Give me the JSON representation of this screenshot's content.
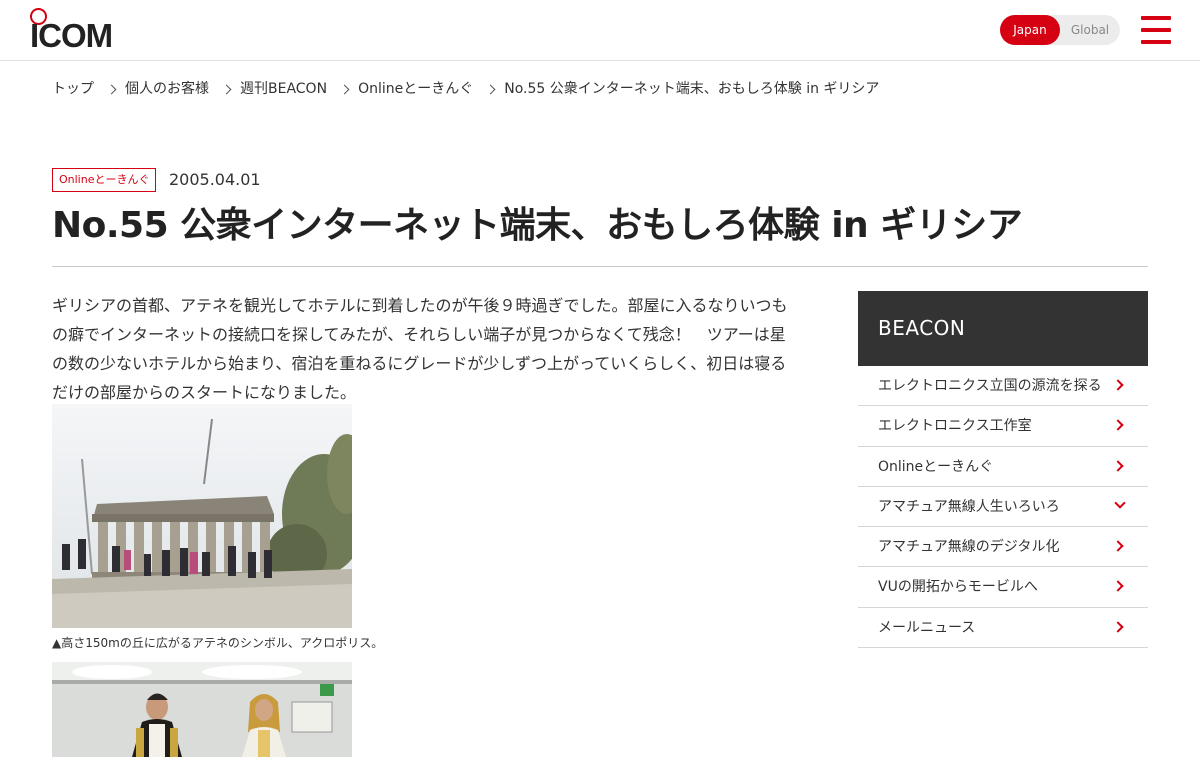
{
  "header": {
    "logo_text": "ICOM",
    "region_japan": "Japan",
    "region_global": "Global",
    "accent_color": "#d50012"
  },
  "breadcrumb": [
    "トップ",
    "個人のお客様",
    "週刊BEACON",
    "Onlineとーきんぐ",
    "No.55 公衆インターネット端末、おもしろ体験 in ギリシア"
  ],
  "meta": {
    "category": "Onlineとーきんぐ",
    "date": "2005.04.01"
  },
  "title": "No.55 公衆インターネット端末、おもしろ体験 in ギリシア",
  "body": {
    "lines": [
      "ギリシアの首都、アテネを観光してホテルに到着したのが午後９時過ぎでした。部屋に入るなりいつも",
      "の癖でインターネットの接続口を探してみたが、それらしい端子が見つからなくて残念！　ツアーは星",
      "の数の少ないホテルから始まり、宿泊を重ねるにグレードが少しずつ上がっていくらしく、初日は寝る",
      "だけの部屋からのスタートになりました。"
    ],
    "caption1": "▲高さ150mの丘に広がるアテネのシンボル、アクロポリス。"
  },
  "sidebar": {
    "title": "BEACON",
    "items": [
      {
        "label": "エレクトロニクス立国の源流を探る",
        "icon": "chevron-right-icon"
      },
      {
        "label": "エレクトロニクス工作室",
        "icon": "chevron-right-icon"
      },
      {
        "label": "Onlineとーきんぐ",
        "icon": "chevron-right-icon"
      },
      {
        "label": "アマチュア無線人生いろいろ",
        "icon": "chevron-down-icon"
      },
      {
        "label": "アマチュア無線のデジタル化",
        "icon": "chevron-right-icon"
      },
      {
        "label": "VUの開拓からモービルへ",
        "icon": "chevron-right-icon"
      },
      {
        "label": "メールニュース",
        "icon": "chevron-right-icon"
      }
    ]
  }
}
